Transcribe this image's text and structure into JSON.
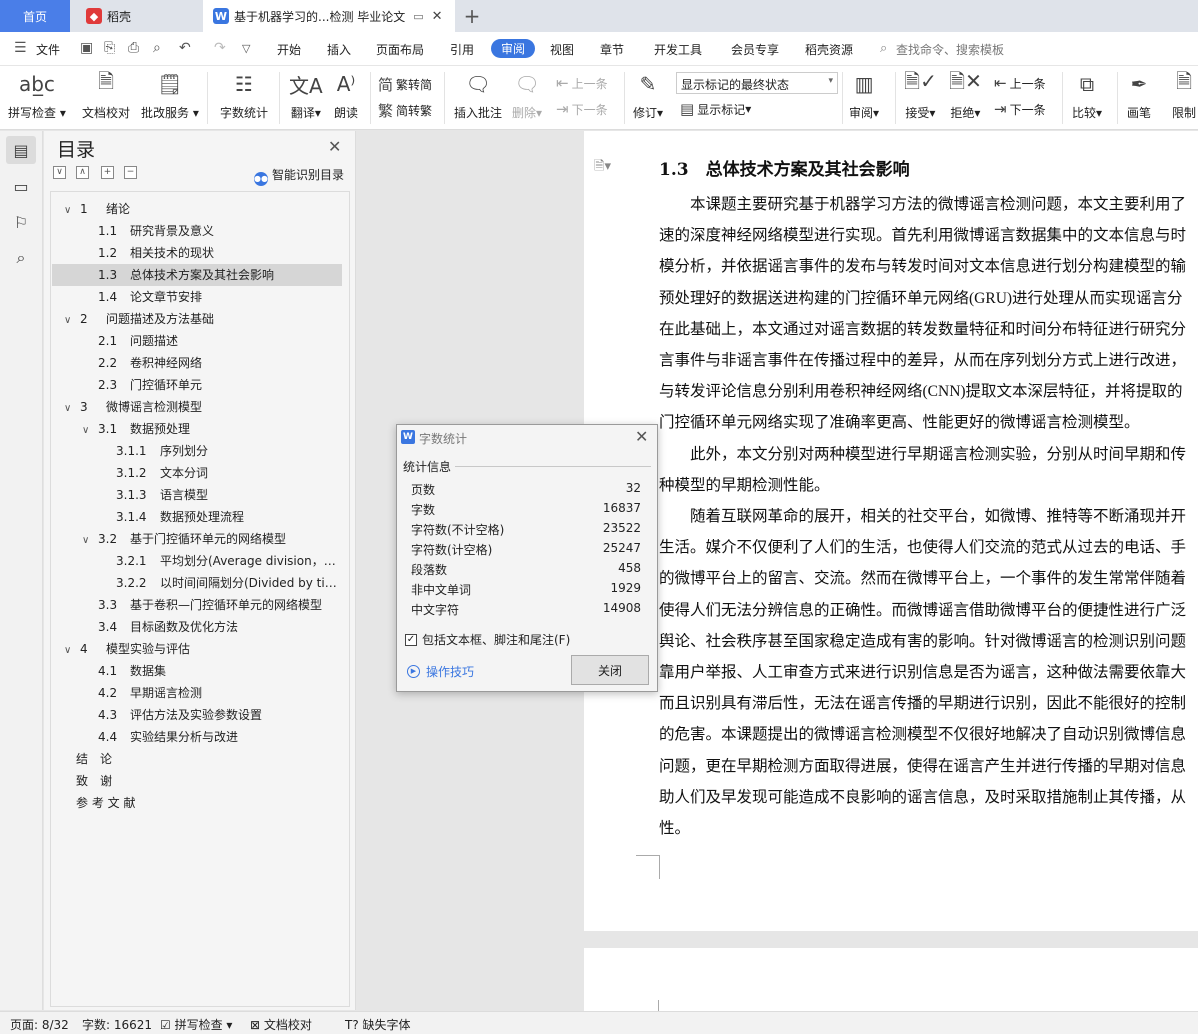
{
  "tabs": {
    "home": "首页",
    "docer": "稻壳",
    "doc": "基于机器学习的...检测 毕业论文"
  },
  "menu": {
    "file": "文件",
    "items": [
      "开始",
      "插入",
      "页面布局",
      "引用",
      "审阅",
      "视图",
      "章节",
      "开发工具",
      "会员专享",
      "稻壳资源"
    ],
    "search": "查找命令、搜索模板"
  },
  "ribbon": {
    "spellcheck": "拼写检查",
    "doccheck": "文档校对",
    "batch": "批改服务",
    "wordcount": "字数统计",
    "translate": "翻译",
    "read": "朗读",
    "trad": "繁转简",
    "simp": "简转繁",
    "insert_comment": "插入批注",
    "delete": "删除",
    "prev": "上一条",
    "next": "下一条",
    "revise": "修订",
    "track_mode": "显示标记的最终状态",
    "show_marks": "显示标记",
    "review": "审阅",
    "accept": "接受",
    "reject": "拒绝",
    "prev2": "上一条",
    "next2": "下一条",
    "compare": "比较",
    "pen": "画笔",
    "restrict": "限制"
  },
  "outline": {
    "title": "目录",
    "smart": "智能识别目录",
    "items": [
      {
        "num": "1",
        "text": "绪论",
        "level": 0,
        "arrow": true
      },
      {
        "num": "1.1",
        "text": "研究背景及意义",
        "level": 1
      },
      {
        "num": "1.2",
        "text": "相关技术的现状",
        "level": 1
      },
      {
        "num": "1.3",
        "text": "总体技术方案及其社会影响",
        "level": 1,
        "selected": true
      },
      {
        "num": "1.4",
        "text": "论文章节安排",
        "level": 1
      },
      {
        "num": "2",
        "text": "问题描述及方法基础",
        "level": 0,
        "arrow": true
      },
      {
        "num": "2.1",
        "text": "问题描述",
        "level": 1
      },
      {
        "num": "2.2",
        "text": "卷积神经网络",
        "level": 1
      },
      {
        "num": "2.3",
        "text": "门控循环单元",
        "level": 1
      },
      {
        "num": "3",
        "text": "微博谣言检测模型",
        "level": 0,
        "arrow": true
      },
      {
        "num": "3.1",
        "text": "数据预处理",
        "level": 1,
        "arrow": true
      },
      {
        "num": "3.1.1",
        "text": "序列划分",
        "level": 2
      },
      {
        "num": "3.1.2",
        "text": "文本分词",
        "level": 2
      },
      {
        "num": "3.1.3",
        "text": "语言模型",
        "level": 2
      },
      {
        "num": "3.1.4",
        "text": "数据预处理流程",
        "level": 2
      },
      {
        "num": "3.2",
        "text": "基于门控循环单元的网络模型",
        "level": 1,
        "arrow": true
      },
      {
        "num": "3.2.1",
        "text": "平均划分(Average division，AD ...",
        "level": 2
      },
      {
        "num": "3.2.2",
        "text": "以时间间隔划分(Divided by tim...",
        "level": 2
      },
      {
        "num": "3.3",
        "text": "基于卷积—门控循环单元的网络模型",
        "level": 1
      },
      {
        "num": "3.4",
        "text": "目标函数及优化方法",
        "level": 1
      },
      {
        "num": "4",
        "text": "模型实验与评估",
        "level": 0,
        "arrow": true
      },
      {
        "num": "4.1",
        "text": "数据集",
        "level": 1
      },
      {
        "num": "4.2",
        "text": "早期谣言检测",
        "level": 1
      },
      {
        "num": "4.3",
        "text": "评估方法及实验参数设置",
        "level": 1
      },
      {
        "num": "4.4",
        "text": "实验结果分析与改进",
        "level": 1
      },
      {
        "num": "",
        "text": "结　论",
        "level": 0
      },
      {
        "num": "",
        "text": "致　谢",
        "level": 0
      },
      {
        "num": "",
        "text": "参 考 文 献",
        "level": 0
      }
    ]
  },
  "doc": {
    "heading": "1.3　总体技术方案及其社会影响",
    "lines": [
      "　　本课题主要研究基于机器学习方法的微博谣言检测问题，本文主要利用了",
      "速的深度神经网络模型进行实现。首先利用微博谣言数据集中的文本信息与时",
      "模分析，并依据谣言事件的发布与转发时间对文本信息进行划分构建模型的输",
      "预处理好的数据送进构建的门控循环单元网络(GRU)进行处理从而实现谣言分",
      "在此基础上，本文通过对谣言数据的转发数量特征和时间分布特征进行研究分",
      "言事件与非谣言事件在传播过程中的差异，从而在序列划分方式上进行改进，",
      "与转发评论信息分别利用卷积神经网络(CNN)提取文本深层特征，并将提取的",
      "门控循环单元网络实现了准确率更高、性能更好的微博谣言检测模型。",
      "　　此外，本文分别对两种模型进行早期谣言检测实验，分别从时间早期和传",
      "种模型的早期检测性能。",
      "　　随着互联网革命的展开，相关的社交平台，如微博、推特等不断涌现并开",
      "生活。媒介不仅便利了人们的生活，也使得人们交流的范式从过去的电话、手",
      "的微博平台上的留言、交流。然而在微博平台上，一个事件的发生常常伴随着",
      "使得人们无法分辨信息的正确性。而微博谣言借助微博平台的便捷性进行广泛",
      "舆论、社会秩序甚至国家稳定造成有害的影响。针对微博谣言的检测识别问题",
      "靠用户举报、人工审查方式来进行识别信息是否为谣言，这种做法需要依靠大",
      "而且识别具有滞后性，无法在谣言传播的早期进行识别，因此不能很好的控制",
      "的危害。本课题提出的微博谣言检测模型不仅很好地解决了自动识别微博信息",
      "问题，更在早期检测方面取得进展，使得在谣言产生并进行传播的早期对信息",
      "助人们及早发现可能造成不良影响的谣言信息，及时采取措施制止其传播，从",
      "性。"
    ]
  },
  "dialog": {
    "title": "字数统计",
    "section": "统计信息",
    "stats": [
      {
        "label": "页数",
        "value": "32"
      },
      {
        "label": "字数",
        "value": "16837"
      },
      {
        "label": "字符数(不计空格)",
        "value": "23522"
      },
      {
        "label": "字符数(计空格)",
        "value": "25247"
      },
      {
        "label": "段落数",
        "value": "458"
      },
      {
        "label": "非中文单词",
        "value": "1929"
      },
      {
        "label": "中文字符",
        "value": "14908"
      }
    ],
    "include": "包括文本框、脚注和尾注(F)",
    "tips": "操作技巧",
    "close": "关闭"
  },
  "status": {
    "page": "页面: 8/32",
    "words": "字数: 16621",
    "spell": "拼写检查",
    "doccheck": "文档校对",
    "font": "缺失字体"
  },
  "colors": {
    "accent": "#3a76e0",
    "selected_row": "#d6d6d6"
  }
}
